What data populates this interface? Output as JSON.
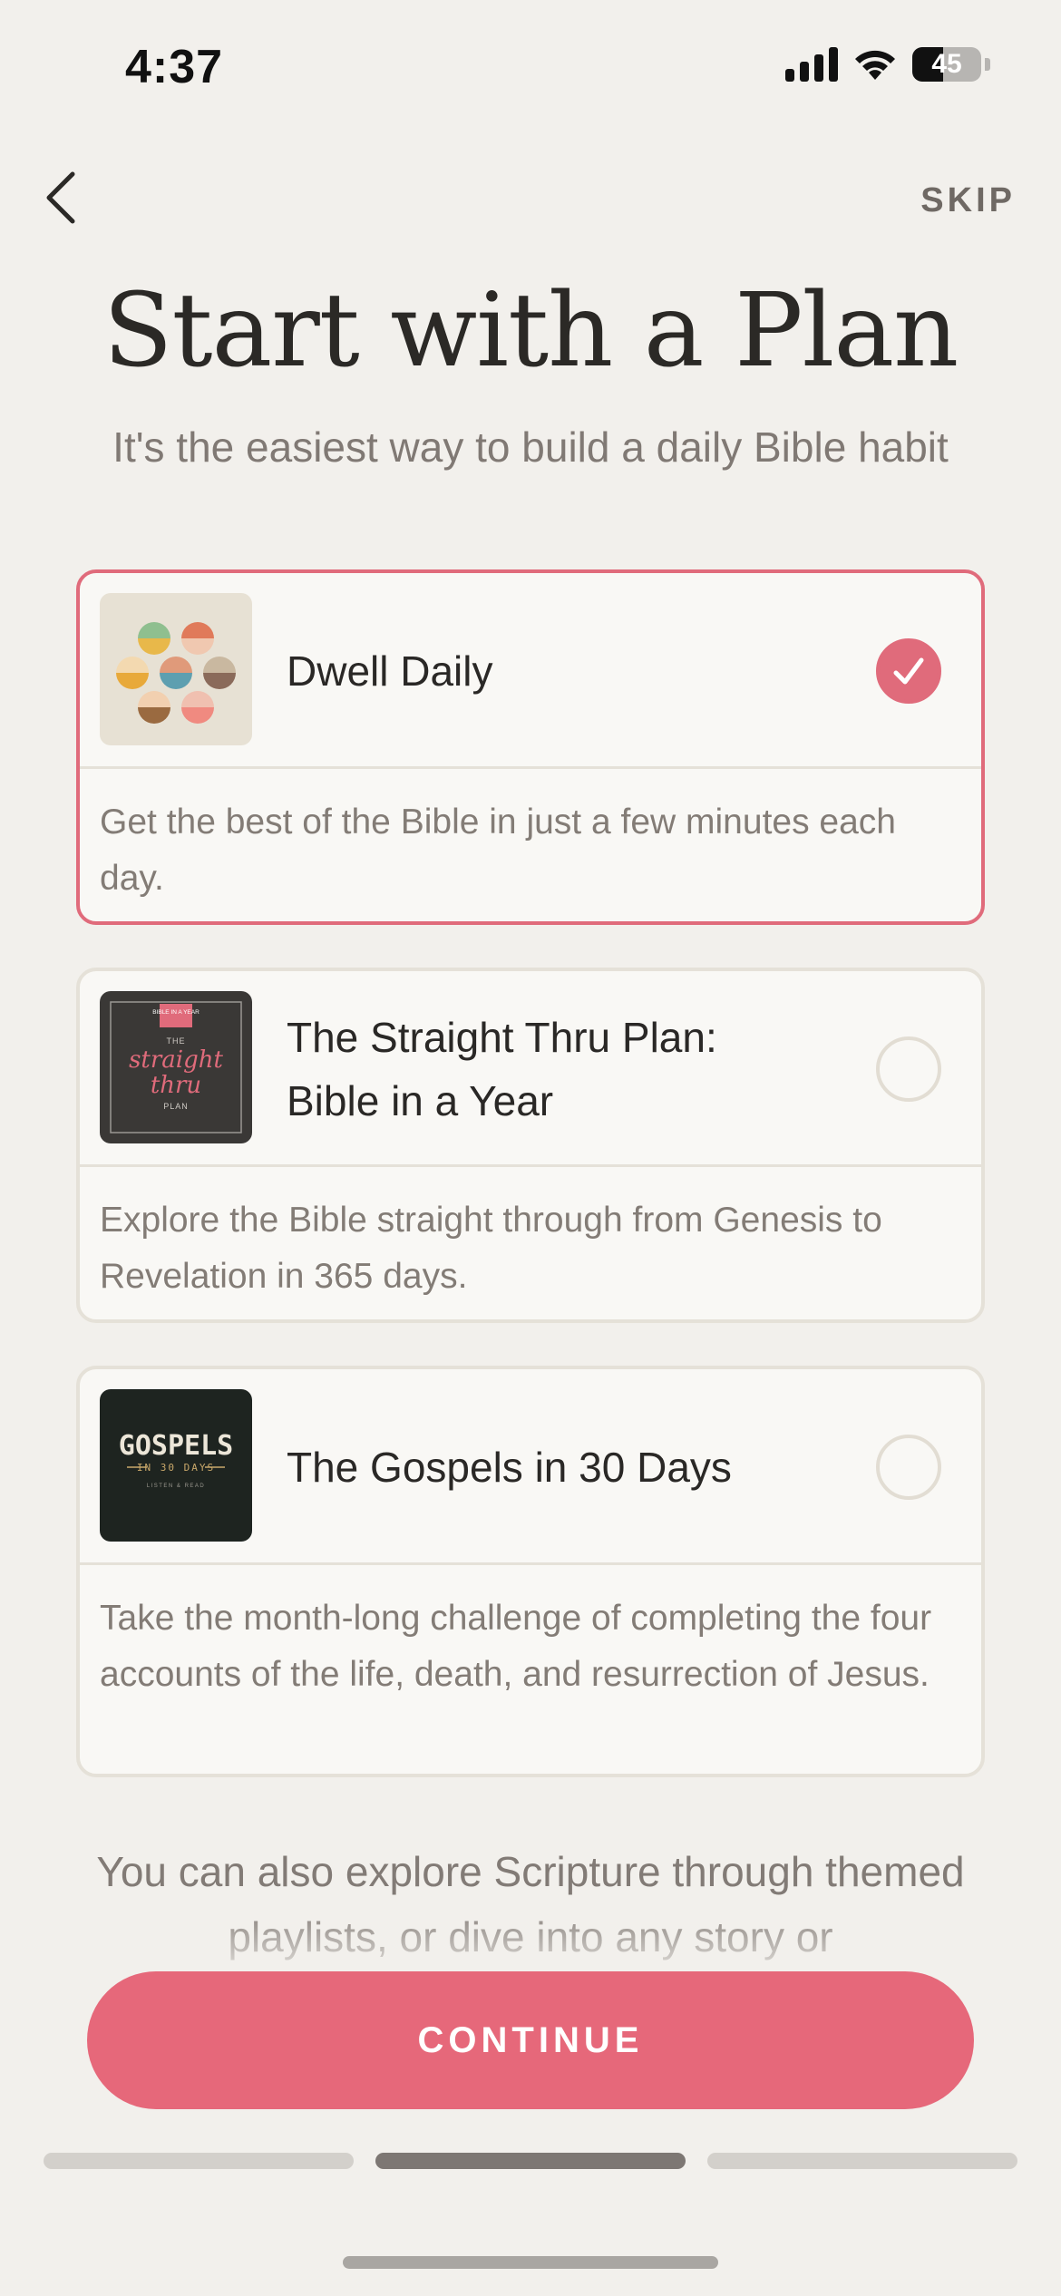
{
  "status": {
    "time": "4:37",
    "battery": "45",
    "battery_level": 0.45
  },
  "nav": {
    "back_icon": "chevron-left-icon",
    "skip_label": "SKIP"
  },
  "title": "Start with a Plan",
  "subtitle": "It's the easiest way to build a daily Bible habit",
  "plans": [
    {
      "name": "Dwell Daily",
      "description": "Get the best of the Bible in just a few minutes each day.",
      "selected": true,
      "thumb_icon": "dwell-daily-artwork"
    },
    {
      "name": "The Straight Thru Plan: Bible in a Year",
      "description": "Explore the Bible straight through from Genesis to Revelation in 365 days.",
      "selected": false,
      "thumb_icon": "straight-thru-artwork",
      "thumb_text": {
        "badge": "BIBLE IN A YEAR",
        "the": "THE",
        "line1": "straight",
        "line2": "thru",
        "plan": "PLAN"
      }
    },
    {
      "name": "The Gospels in 30 Days",
      "description": "Take the month-long challenge of completing the four accounts of the life, death, and resurrection of Jesus.",
      "selected": false,
      "thumb_icon": "gospels-artwork",
      "thumb_text": {
        "title": "GOSPELS",
        "sub": "IN 30 DAYS",
        "small": "LISTEN & READ"
      }
    }
  ],
  "explore_text": "You can also explore Scripture through themed playlists, or dive into any story or",
  "continue_label": "CONTINUE",
  "progress": {
    "steps": 3,
    "current": 2
  },
  "colors": {
    "accent": "#e6687a",
    "background": "#f2f0ec",
    "card_border": "#e5e1d8"
  }
}
